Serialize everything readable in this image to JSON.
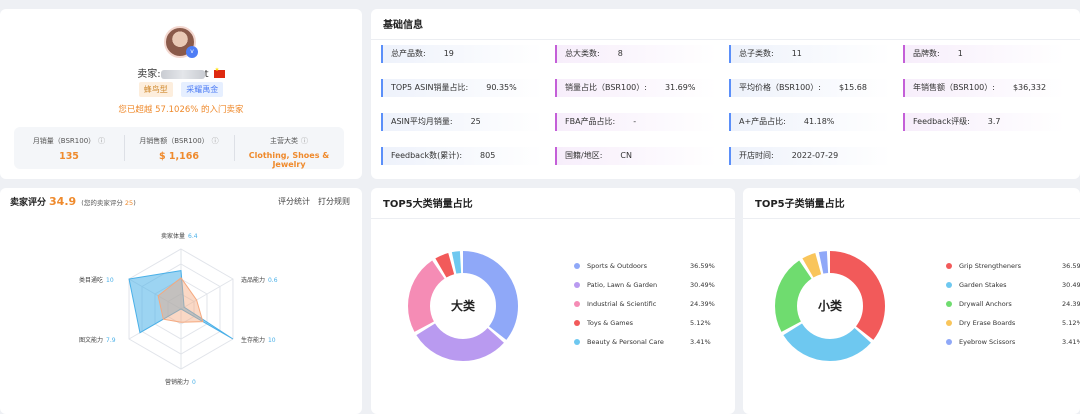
{
  "seller": {
    "label": "卖家:",
    "name_suffix": "t",
    "tags": [
      "蜂鸟型",
      "采耀禹金"
    ],
    "beat_text": "您已超越 57.1026% 的入门卖家",
    "stats": [
      {
        "label": "月销量（BSR100）",
        "value": "135"
      },
      {
        "label": "月销售额（BSR100）",
        "value": "$ 1,166"
      },
      {
        "label": "主营大类",
        "value": "Clothing, Shoes & Jewelry"
      }
    ],
    "info_glyph": "ⓘ"
  },
  "basic": {
    "title": "基础信息",
    "rows": [
      [
        {
          "label": "总产品数:",
          "value": "19"
        },
        {
          "label": "总大类数:",
          "value": "8"
        },
        {
          "label": "总子类数:",
          "value": "11"
        },
        {
          "label": "品牌数:",
          "value": "1"
        }
      ],
      [
        {
          "label": "TOP5 ASIN销量占比:",
          "value": "90.35%"
        },
        {
          "label": "销量占比（BSR100）:",
          "value": "31.69%"
        },
        {
          "label": "平均价格（BSR100）:",
          "value": "$15.68"
        },
        {
          "label": "年销售额（BSR100）:",
          "value": "$36,332"
        }
      ],
      [
        {
          "label": "ASIN平均月销量:",
          "value": "25"
        },
        {
          "label": "FBA产品占比:",
          "value": "-"
        },
        {
          "label": "A+产品占比:",
          "value": "41.18%"
        },
        {
          "label": "Feedback评级:",
          "value": "3.7"
        }
      ],
      [
        {
          "label": "Feedback数(累计):",
          "value": "805"
        },
        {
          "label": "国籍/地区:",
          "value": "CN"
        },
        {
          "label": "开店时间:",
          "value": "2022-07-29"
        }
      ]
    ]
  },
  "score": {
    "title": "卖家评分",
    "value": "34.9",
    "sub_prefix": "(您的卖家评分",
    "sub_value": "25",
    "sub_suffix": ")",
    "links": [
      "评分统计",
      "打分规则"
    ],
    "radar": [
      {
        "name": "卖家体量",
        "value": 6.4
      },
      {
        "name": "选品能力",
        "value": 0.6
      },
      {
        "name": "生存能力",
        "value": 10
      },
      {
        "name": "营销能力",
        "value": 0
      },
      {
        "name": "图文能力",
        "value": 7.9
      },
      {
        "name": "类目通吃",
        "value": 10
      }
    ],
    "radar_colors": {
      "seller": "#4ab0e8",
      "own": "#f5a97f"
    }
  },
  "top5_main": {
    "title": "TOP5大类销量占比",
    "center_label": "大类",
    "items": [
      {
        "name": "Sports & Outdoors",
        "pct": "36.59%",
        "value": 36.59,
        "color": "#8fa8f8"
      },
      {
        "name": "Patio, Lawn & Garden",
        "pct": "30.49%",
        "value": 30.49,
        "color": "#b99af0"
      },
      {
        "name": "Industrial & Scientific",
        "pct": "24.39%",
        "value": 24.39,
        "color": "#f58cb5"
      },
      {
        "name": "Toys & Games",
        "pct": "5.12%",
        "value": 5.12,
        "color": "#f25a5a"
      },
      {
        "name": "Beauty & Personal Care",
        "pct": "3.41%",
        "value": 3.41,
        "color": "#6ec8f0"
      }
    ]
  },
  "top5_sub": {
    "title": "TOP5子类销量占比",
    "center_label": "小类",
    "items": [
      {
        "name": "Grip Strengtheners",
        "pct": "36.59%",
        "value": 36.59,
        "color": "#f25a5a"
      },
      {
        "name": "Garden Stakes",
        "pct": "30.49%",
        "value": 30.49,
        "color": "#6ec8f0"
      },
      {
        "name": "Drywall Anchors",
        "pct": "24.39%",
        "value": 24.39,
        "color": "#6fdc6f"
      },
      {
        "name": "Dry Erase Boards",
        "pct": "5.12%",
        "value": 5.12,
        "color": "#f9c55b"
      },
      {
        "name": "Eyebrow Scissors",
        "pct": "3.41%",
        "value": 3.41,
        "color": "#8fa8f8"
      }
    ]
  },
  "chart_data": [
    {
      "type": "radar",
      "title": "卖家评分",
      "categories": [
        "卖家体量",
        "选品能力",
        "生存能力",
        "营销能力",
        "图文能力",
        "类目通吃"
      ],
      "values": [
        6.4,
        0.6,
        10,
        0,
        7.9,
        10
      ],
      "ylim": [
        0,
        10
      ]
    },
    {
      "type": "pie",
      "title": "TOP5大类销量占比",
      "categories": [
        "Sports & Outdoors",
        "Patio, Lawn & Garden",
        "Industrial & Scientific",
        "Toys & Games",
        "Beauty & Personal Care"
      ],
      "values": [
        36.59,
        30.49,
        24.39,
        5.12,
        3.41
      ]
    },
    {
      "type": "pie",
      "title": "TOP5子类销量占比",
      "categories": [
        "Grip Strengtheners",
        "Garden Stakes",
        "Drywall Anchors",
        "Dry Erase Boards",
        "Eyebrow Scissors"
      ],
      "values": [
        36.59,
        30.49,
        24.39,
        5.12,
        3.41
      ]
    }
  ]
}
